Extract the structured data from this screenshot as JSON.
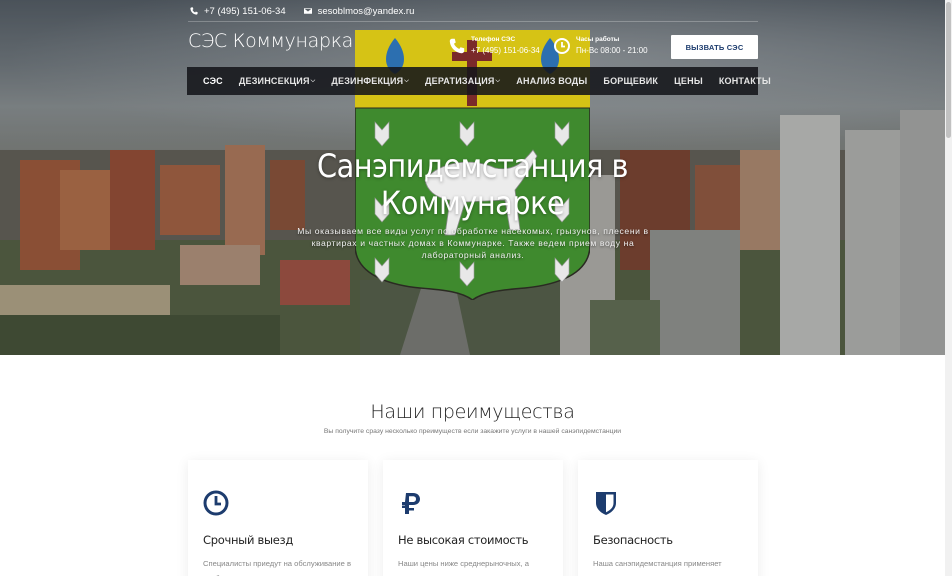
{
  "topbar": {
    "phone": "+7 (495) 151-06-34",
    "email": "sesoblmos@yandex.ru"
  },
  "header": {
    "site_title": "СЭС Коммунарка",
    "phone_label": "Телефон СЭС",
    "phone_value": "+7 (495) 151-06-34",
    "hours_label": "Часы работы",
    "hours_value": "Пн-Вс 08:00 - 21:00",
    "call_button": "ВЫЗВАТЬ СЭС"
  },
  "nav": {
    "items": [
      {
        "label": "СЭС"
      },
      {
        "label": "ДЕЗИНСЕКЦИЯ"
      },
      {
        "label": "ДЕЗИНФЕКЦИЯ"
      },
      {
        "label": "ДЕРАТИЗАЦИЯ"
      },
      {
        "label": "АНАЛИЗ ВОДЫ"
      },
      {
        "label": "БОРЩЕВИК"
      },
      {
        "label": "ЦЕНЫ"
      },
      {
        "label": "КОНТАКТЫ"
      }
    ]
  },
  "hero": {
    "title": "Санэпидемстанция в Коммунарке",
    "subtitle": "Мы оказываем все виды услуг по обработке насекомых, грызунов, плесени в квартирах и частных домах в Коммунарке. Также ведем прием воду на лабораторный анализ."
  },
  "advantages": {
    "title": "Наши преимущества",
    "subtitle": "Вы получите сразу несколько преимуществ если закажите услуги в нашей санэпидемстанции",
    "cards": [
      {
        "icon": "clock-icon",
        "title": "Срочный выезд",
        "text": "Специалисты приедут на обслуживание в удобное для вас время"
      },
      {
        "icon": "ruble-icon",
        "title": "Не высокая стоимость",
        "text": "Наши цены ниже среднерыночных, а качество услуг поддерживается на высоком"
      },
      {
        "icon": "shield-icon",
        "title": "Безопасность",
        "text": "Наша санэпидемстанция применяет качественные препараты и дает гарантию на"
      }
    ]
  },
  "colors": {
    "accent": "#1d3c6e",
    "nav_bg": "#14161a",
    "emblem_yellow": "#d6c315",
    "emblem_green": "#3f8a2e"
  }
}
